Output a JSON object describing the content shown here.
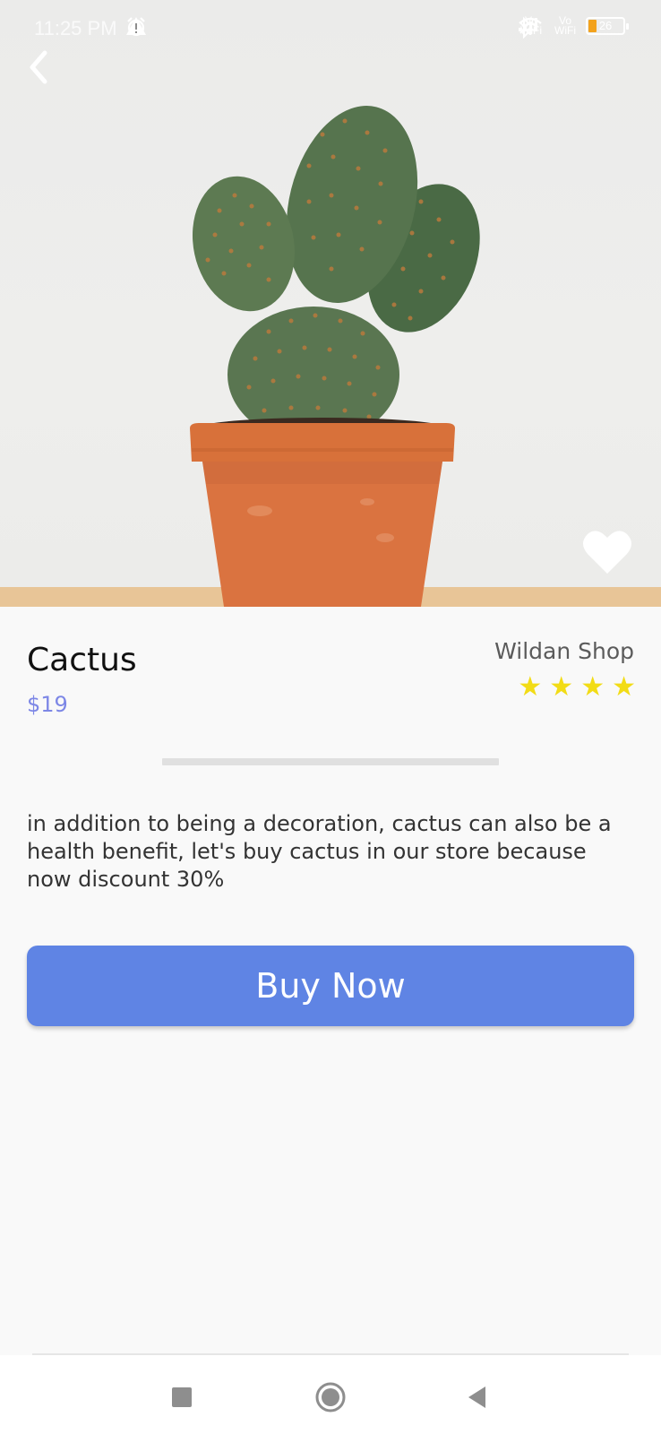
{
  "status_bar": {
    "time": "11:25 PM",
    "vo_wifi_1": "Vo WiFi",
    "vo_wifi_2": "Vo WiFi",
    "battery": "26"
  },
  "product": {
    "name": "Cactus",
    "price": "$19",
    "shop": "Wildan Shop",
    "rating": 4,
    "stars": [
      "★",
      "★",
      "★",
      "★"
    ],
    "description": "in addition to being a decoration, cactus can also be a health benefit, let's buy cactus in our store because now discount 30%"
  },
  "actions": {
    "buy_label": "Buy Now"
  },
  "colors": {
    "accent": "#5f84e4",
    "price": "#7d87e6",
    "star": "#f2dc16",
    "background": "#f9f9f9"
  },
  "icons": {
    "back": "chevron-left-icon",
    "favorite": "heart-icon",
    "nav_recent": "square-icon",
    "nav_home": "circle-icon",
    "nav_back": "triangle-left-icon"
  }
}
